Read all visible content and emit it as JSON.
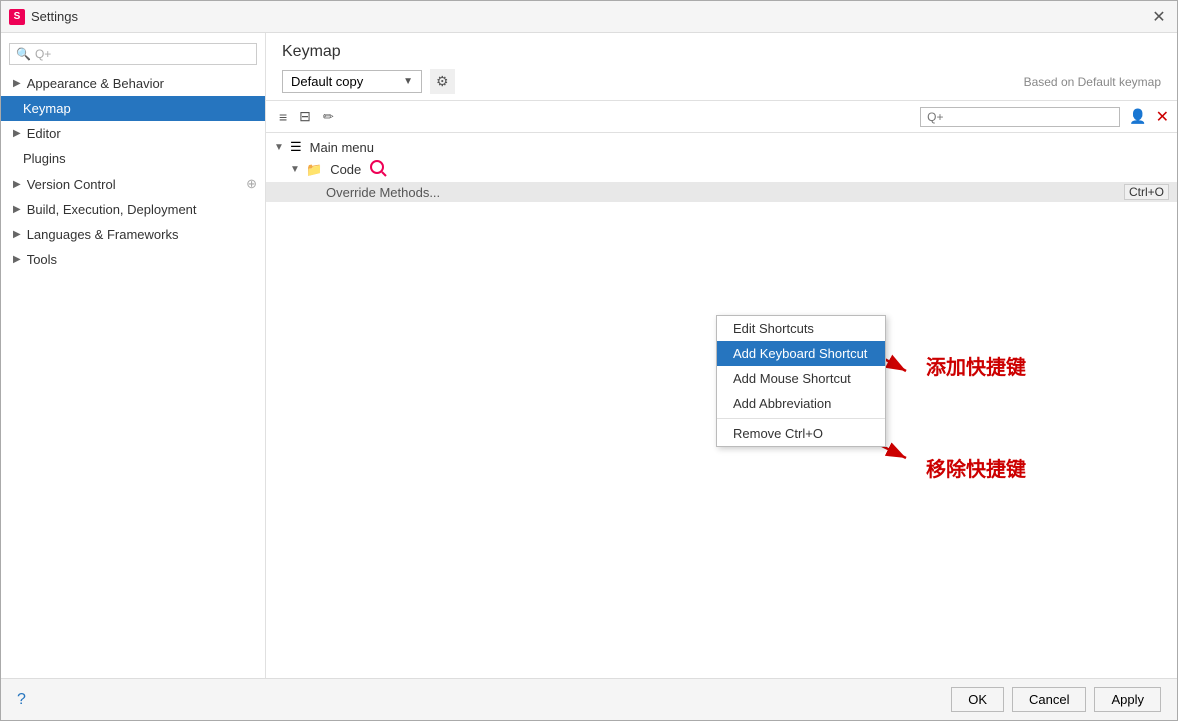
{
  "window": {
    "title": "Settings",
    "icon": "S"
  },
  "sidebar": {
    "search_placeholder": "Q+",
    "items": [
      {
        "id": "appearance",
        "label": "Appearance & Behavior",
        "indent": 0,
        "hasChevron": true,
        "expanded": false,
        "selected": false
      },
      {
        "id": "keymap",
        "label": "Keymap",
        "indent": 1,
        "hasChevron": false,
        "expanded": false,
        "selected": true
      },
      {
        "id": "editor",
        "label": "Editor",
        "indent": 0,
        "hasChevron": true,
        "expanded": false,
        "selected": false
      },
      {
        "id": "plugins",
        "label": "Plugins",
        "indent": 1,
        "hasChevron": false,
        "expanded": false,
        "selected": false
      },
      {
        "id": "version-control",
        "label": "Version Control",
        "indent": 0,
        "hasChevron": true,
        "expanded": false,
        "selected": false
      },
      {
        "id": "build",
        "label": "Build, Execution, Deployment",
        "indent": 0,
        "hasChevron": true,
        "expanded": false,
        "selected": false
      },
      {
        "id": "languages",
        "label": "Languages & Frameworks",
        "indent": 0,
        "hasChevron": true,
        "expanded": false,
        "selected": false
      },
      {
        "id": "tools",
        "label": "Tools",
        "indent": 0,
        "hasChevron": true,
        "expanded": false,
        "selected": false
      }
    ]
  },
  "panel": {
    "title": "Keymap",
    "keymap_value": "Default copy",
    "based_on": "Based on Default keymap",
    "search_placeholder": "Q+"
  },
  "tree": {
    "items": [
      {
        "id": "main-menu",
        "label": "Main menu",
        "indent": 0,
        "expanded": true,
        "icon": "☰"
      },
      {
        "id": "code",
        "label": "Code",
        "indent": 1,
        "expanded": true,
        "icon": "📁"
      },
      {
        "id": "override",
        "label": "Override Methods...",
        "indent": 2,
        "shortcut": "Ctrl+O"
      }
    ]
  },
  "context_menu": {
    "items": [
      {
        "id": "edit-shortcuts",
        "label": "Edit Shortcuts",
        "selected": false
      },
      {
        "id": "add-keyboard-shortcut",
        "label": "Add Keyboard Shortcut",
        "selected": true
      },
      {
        "id": "add-mouse-shortcut",
        "label": "Add Mouse Shortcut",
        "selected": false
      },
      {
        "id": "add-abbreviation",
        "label": "Add Abbreviation",
        "selected": false
      },
      {
        "id": "divider",
        "label": "",
        "isDivider": true
      },
      {
        "id": "remove-ctrl-o",
        "label": "Remove Ctrl+O",
        "selected": false
      }
    ]
  },
  "annotations": {
    "add_label": "添加快捷键",
    "remove_label": "移除快捷键"
  },
  "toolbar": {
    "expand_all": "≡",
    "collapse_all": "≡",
    "edit_icon": "✏"
  },
  "bottom": {
    "help_icon": "?",
    "ok_label": "OK",
    "cancel_label": "Cancel",
    "apply_label": "Apply"
  }
}
